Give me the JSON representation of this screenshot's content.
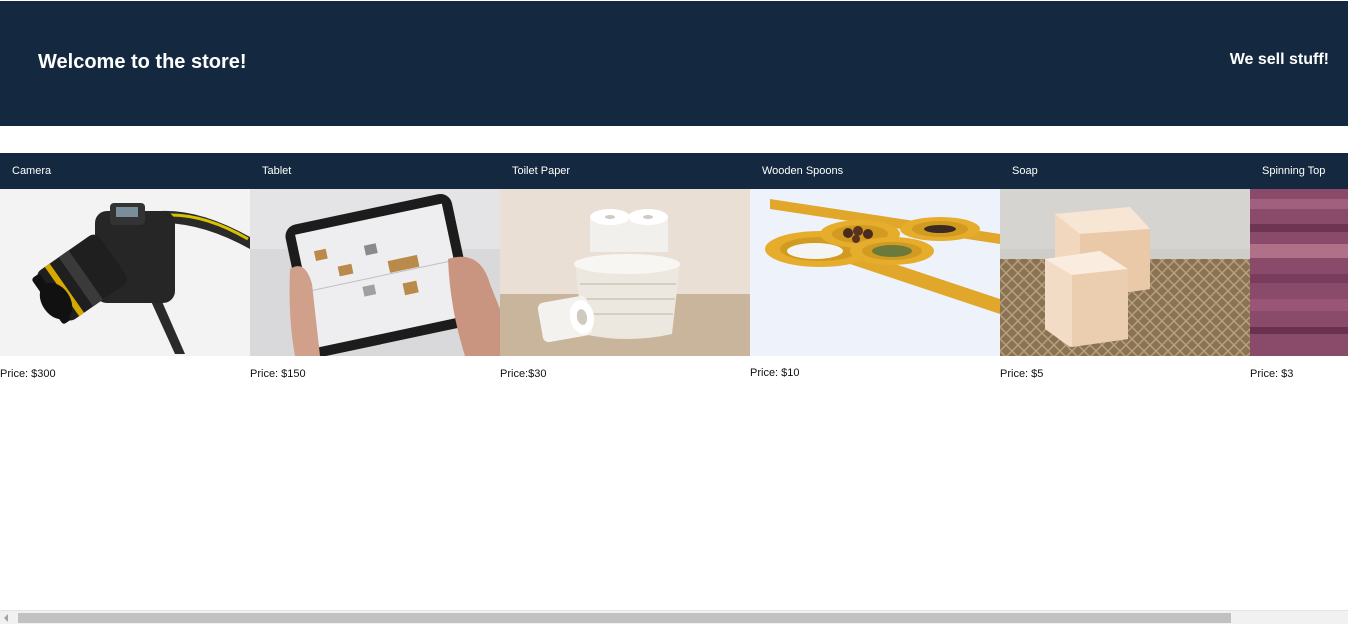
{
  "header": {
    "title": "Welcome to the store!",
    "tagline": "We sell stuff!"
  },
  "products": [
    {
      "name": "Camera",
      "price": "Price: $300",
      "image": "camera-photo"
    },
    {
      "name": "Tablet",
      "price": "Price: $150",
      "image": "tablet-photo"
    },
    {
      "name": "Toilet Paper",
      "price": "Price:$30",
      "image": "toilet-paper-photo"
    },
    {
      "name": "Wooden Spoons",
      "price": "Price: $10",
      "image": "wooden-spoons-photo"
    },
    {
      "name": "Soap",
      "price": "Price: $5",
      "image": "soap-photo"
    },
    {
      "name": "Spinning Top",
      "price": "Price: $3",
      "image": "spinning-top-photo"
    }
  ],
  "colors": {
    "header_bg": "#14293f",
    "header_text": "#ffffff"
  }
}
